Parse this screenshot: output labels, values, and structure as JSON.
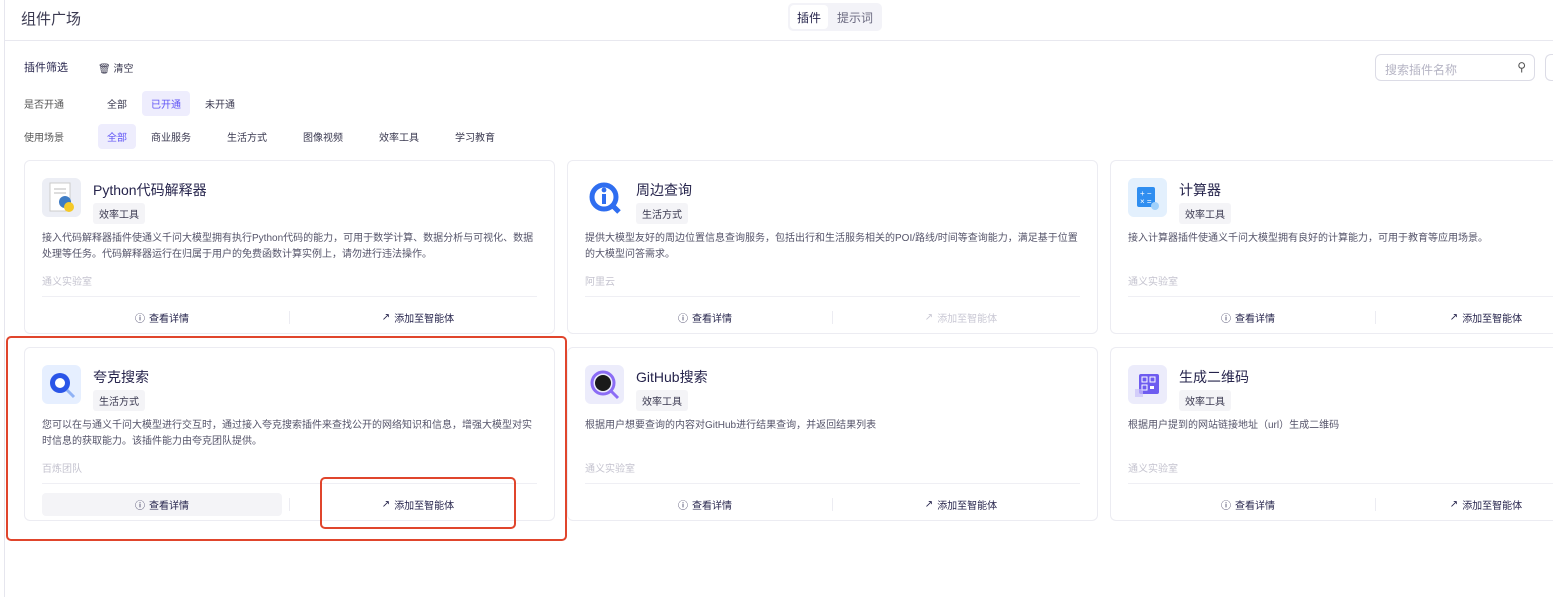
{
  "header": {
    "title": "组件广场",
    "tabs": [
      {
        "label": "插件",
        "active": true
      },
      {
        "label": "提示词",
        "active": false
      }
    ]
  },
  "search": {
    "placeholder": "搜索插件名称",
    "icon": "search-icon"
  },
  "filter": {
    "title": "插件筛选",
    "clear_label": "清空",
    "status": {
      "label": "是否开通",
      "options": [
        "全部",
        "已开通",
        "未开通"
      ],
      "selected": "已开通"
    },
    "scene": {
      "label": "使用场景",
      "options": [
        "全部",
        "商业服务",
        "生活方式",
        "图像视频",
        "效率工具",
        "学习教育"
      ],
      "selected": "全部"
    }
  },
  "actions": {
    "details": "查看详情",
    "add": "添加至智能体"
  },
  "cards": [
    {
      "title": "Python代码解释器",
      "tag": "效率工具",
      "desc": "接入代码解释器插件使通义千问大模型拥有执行Python代码的能力，可用于数学计算、数据分析与可视化、数据处理等任务。代码解释器运行在归属于用户的免费函数计算实例上，请勿进行违法操作。",
      "provider": "通义实验室",
      "add_disabled": false
    },
    {
      "title": "周边查询",
      "tag": "生活方式",
      "desc": "提供大模型友好的周边位置信息查询服务，包括出行和生活服务相关的POI/路线/时间等查询能力，满足基于位置的大模型问答需求。",
      "provider": "阿里云",
      "add_disabled": true
    },
    {
      "title": "计算器",
      "tag": "效率工具",
      "desc": "接入计算器插件使通义千问大模型拥有良好的计算能力，可用于教育等应用场景。",
      "provider": "通义实验室",
      "add_disabled": false
    },
    {
      "title": "夸克搜索",
      "tag": "生活方式",
      "desc": "您可以在与通义千问大模型进行交互时，通过接入夸克搜索插件来查找公开的网络知识和信息，增强大模型对实时信息的获取能力。该插件能力由夸克团队提供。",
      "provider": "百炼团队",
      "add_disabled": false
    },
    {
      "title": "GitHub搜索",
      "tag": "效率工具",
      "desc": "根据用户想要查询的内容对GitHub进行结果查询，并返回结果列表",
      "provider": "通义实验室",
      "add_disabled": false
    },
    {
      "title": "生成二维码",
      "tag": "效率工具",
      "desc": "根据用户提到的网站链接地址（url）生成二维码",
      "provider": "通义实验室",
      "add_disabled": false
    }
  ],
  "colors": {
    "accent": "#6155f5",
    "highlight": "#e0452c"
  }
}
